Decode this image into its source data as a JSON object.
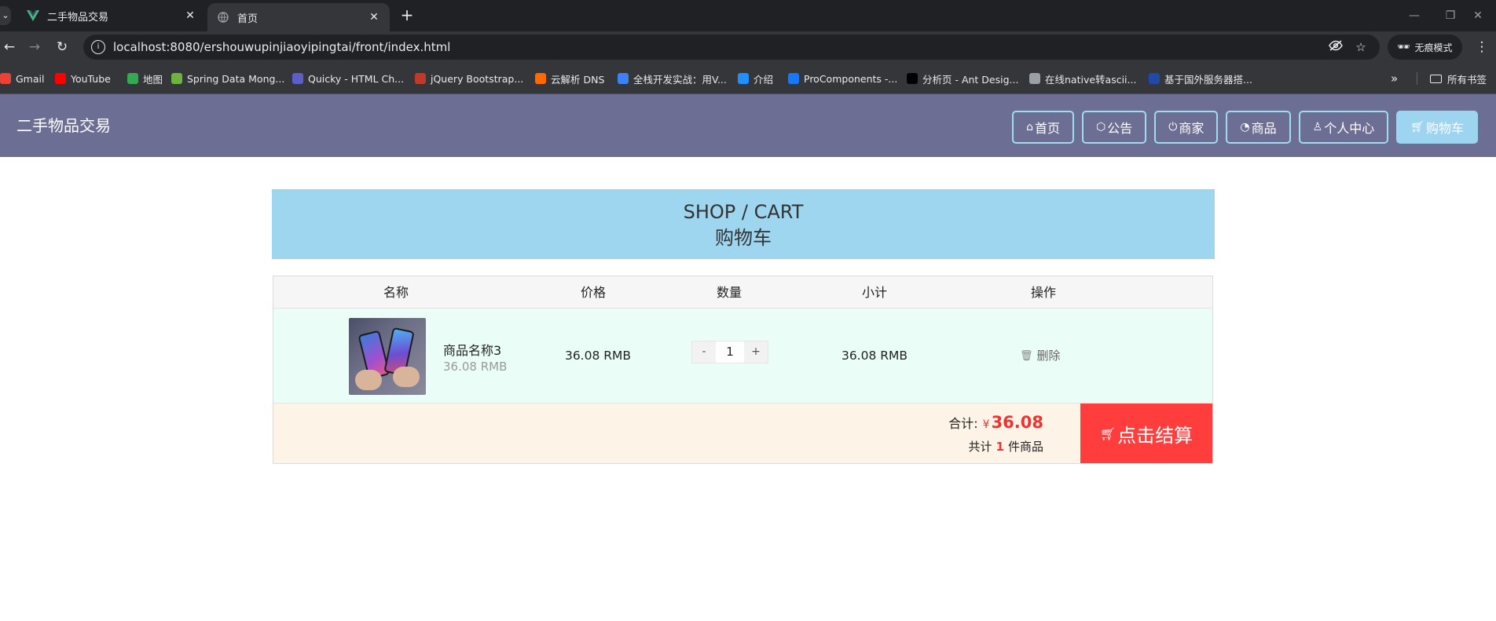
{
  "browser": {
    "tabs": [
      {
        "title": "二手物品交易",
        "favicon": "vue-logo-icon"
      },
      {
        "title": "首页",
        "favicon": "globe-icon"
      }
    ],
    "url": "localhost:8080/ershouwupinjiaoyipingtai/front/index.html",
    "incognito_label": "无痕模式",
    "bookmarks": [
      {
        "label": "Gmail",
        "color": "#ea4335"
      },
      {
        "label": "YouTube",
        "color": "#ff0000"
      },
      {
        "label": "地图",
        "color": "#34a853"
      },
      {
        "label": "Spring Data Mong...",
        "color": "#6db33f"
      },
      {
        "label": "Quicky - HTML Ch...",
        "color": "#5b5fc7"
      },
      {
        "label": "jQuery Bootstrap...",
        "color": "#c0392b"
      },
      {
        "label": "云解析 DNS",
        "color": "#ff6a00"
      },
      {
        "label": "全栈开发实战：用V...",
        "color": "#3b82f6"
      },
      {
        "label": "介绍",
        "color": "#1e90ff"
      },
      {
        "label": "ProComponents -...",
        "color": "#1677ff"
      },
      {
        "label": "分析页 - Ant Desig...",
        "color": "#000000"
      },
      {
        "label": "在线native转ascii...",
        "color": "#9aa0a6"
      },
      {
        "label": "基于国外服务器搭...",
        "color": "#1f4aa8"
      }
    ],
    "all_bookmarks_label": "所有书签"
  },
  "site": {
    "brand": "二手物品交易",
    "nav": [
      {
        "label": "首页",
        "icon": "home-icon"
      },
      {
        "label": "公告",
        "icon": "box-icon"
      },
      {
        "label": "商家",
        "icon": "power-icon"
      },
      {
        "label": "商品",
        "icon": "gauge-icon"
      },
      {
        "label": "个人中心",
        "icon": "user-icon"
      },
      {
        "label": "购物车",
        "icon": "cart-icon",
        "active": true
      }
    ],
    "header_color": "#6c6f93"
  },
  "cart": {
    "title_en": "SHOP / CART",
    "title_zh": "购物车",
    "columns": [
      "名称",
      "价格",
      "数量",
      "小计",
      "操作"
    ],
    "items": [
      {
        "name": "商品名称3",
        "unit_price": "36.08 RMB",
        "price": "36.08 RMB",
        "quantity": "1",
        "subtotal": "36.08 RMB",
        "delete_label": "删除"
      }
    ],
    "stepper": {
      "minus": "-",
      "plus": "+"
    },
    "total_label": "合计:",
    "currency_symbol": "¥",
    "total": "36.08",
    "count_prefix": "共计",
    "count": "1",
    "count_suffix": "件商品",
    "checkout_label": "点击结算",
    "accent_color": "#ff3d3d"
  }
}
